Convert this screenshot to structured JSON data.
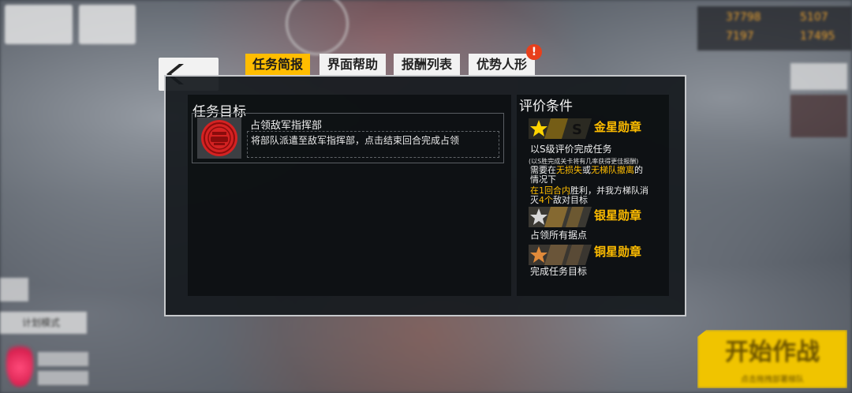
{
  "tabs": [
    {
      "label": "任务简报",
      "active": true
    },
    {
      "label": "界面帮助",
      "active": false
    },
    {
      "label": "报酬列表",
      "active": false
    },
    {
      "label": "优势人形",
      "active": false,
      "badge": "!"
    }
  ],
  "objective": {
    "section_title": "任务目标",
    "name": "占领敌军指挥部",
    "description": "将部队派遣至敌军指挥部，点击结束回合完成占领",
    "icon": "enemy-command-emblem-icon"
  },
  "evaluation": {
    "section_title": "评价条件",
    "gold": {
      "label": "金星勋章",
      "grade_letter": "S",
      "line1": "以S级评价完成任务",
      "note": "(以S胜完成关卡将有几率获得更佳报酬)",
      "line2_a": "需要在",
      "line2_b": "无损失",
      "line2_c": "或",
      "line2_d": "无梯队撤离",
      "line2_e": "的",
      "line3": "情况下",
      "line4_a": "在1回合内",
      "line4_b": "胜利，并我方梯队消",
      "line5_a": "灭",
      "line5_b": "4个",
      "line5_c": "敌对目标"
    },
    "silver": {
      "label": "银星勋章",
      "condition": "占领所有据点"
    },
    "bronze": {
      "label": "铜星勋章",
      "condition": "完成任务目标"
    }
  },
  "start_button": {
    "label": "开始作战",
    "sub": "点击拖拽部署梯队"
  },
  "hud": {
    "res1": "37798",
    "res2": "5107",
    "res3": "7197",
    "res4": "17495",
    "mode": "计划模式"
  },
  "colors": {
    "accent": "#ffbd00",
    "panel_bg": "#161a1e",
    "badge": "#e8401c"
  }
}
